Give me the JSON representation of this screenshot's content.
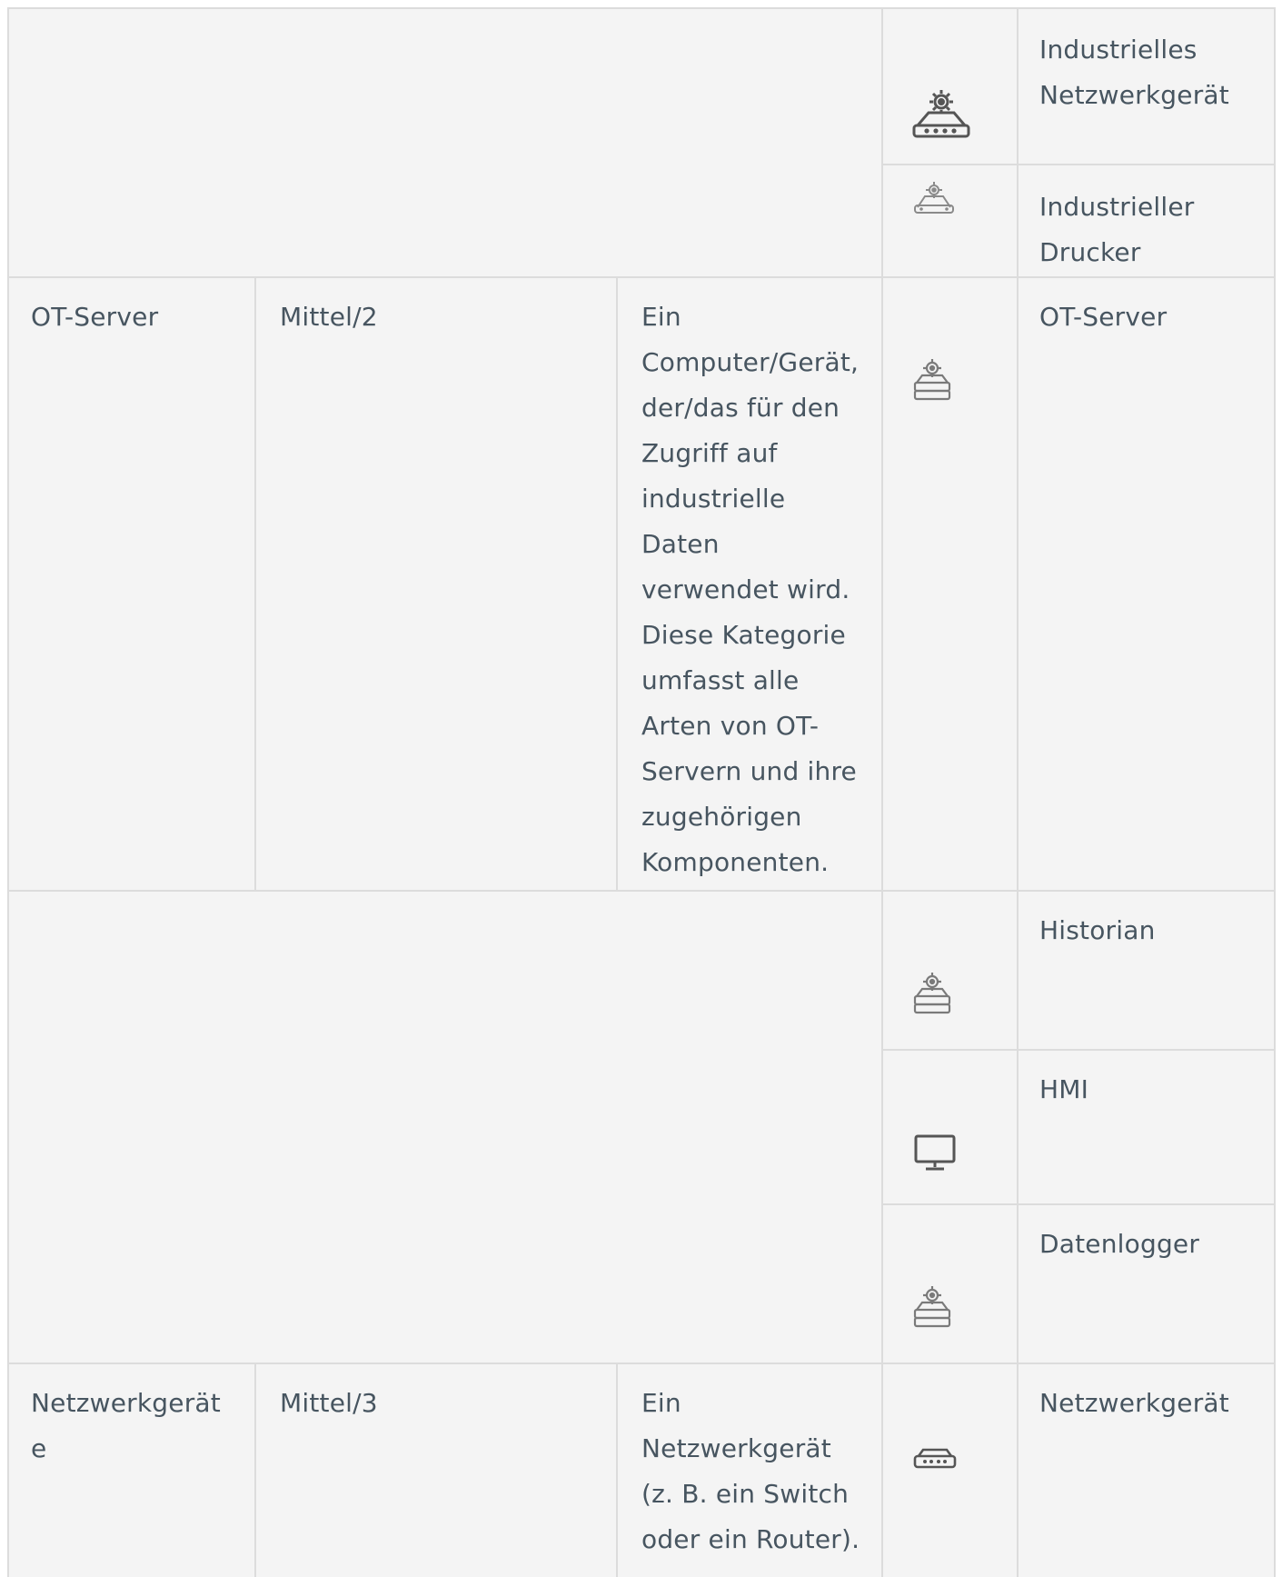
{
  "rows": [
    {
      "type": "icon-only",
      "label": "Industrielles\nNetzwerkgerät",
      "icon": "industrial-network-device-icon"
    },
    {
      "type": "icon-only",
      "label": "Industrieller\nDrucker",
      "icon": "industrial-printer-icon"
    },
    {
      "type": "full",
      "category": "OT-Server",
      "level": "Mittel/2",
      "description": "Ein\nComputer/Gerät,\nder/das für den\nZugriff auf\nindustrielle\nDaten\nverwendet wird.\nDiese Kategorie\numfasst alle\nArten von OT-\nServern und ihre\nzugehörigen\nKomponenten.",
      "label": "OT-Server",
      "icon": "ot-server-icon"
    },
    {
      "type": "icon-only",
      "label": "Historian",
      "icon": "historian-server-icon"
    },
    {
      "type": "icon-only",
      "label": "HMI",
      "icon": "hmi-monitor-icon"
    },
    {
      "type": "icon-only",
      "label": "Datenlogger",
      "icon": "datalogger-server-icon"
    },
    {
      "type": "full",
      "category": "Netzwerkgerät\ne",
      "level": "Mittel/3",
      "description": "Ein\nNetzwerkgerät\n(z. B. ein Switch\noder ein Router).",
      "label": "Netzwerkgerät",
      "icon": "network-device-icon"
    }
  ]
}
